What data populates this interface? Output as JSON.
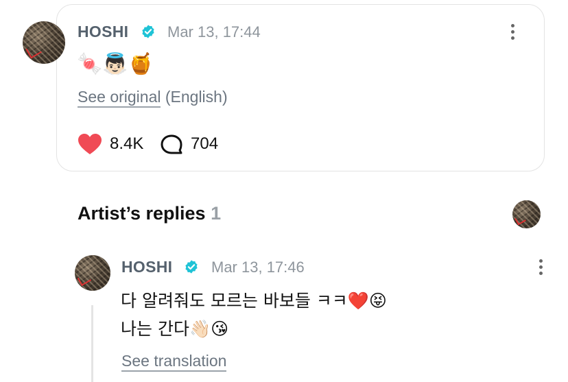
{
  "post": {
    "author": "HOSHI",
    "timestamp": "Mar 13, 17:44",
    "emojis": "🍬👼🏻🍯",
    "see_original": "See original",
    "language": "(English)",
    "likes": "8.4K",
    "comments": "704"
  },
  "replies_section": {
    "title": "Artist’s replies",
    "count": "1"
  },
  "reply": {
    "author": "HOSHI",
    "timestamp": "Mar 13, 17:46",
    "line1": "다 알려줘도 모르는 바보들 ㅋㅋ❤️😝",
    "line2": "나는 간다👋🏻😘",
    "see_translation": "See translation"
  },
  "colors": {
    "heart": "#f04a55",
    "verified": "#1fc3d6",
    "name": "#55616d",
    "muted": "#8e959c"
  },
  "icons": {
    "like": "heart-icon",
    "comment": "comment-bubble-icon",
    "more": "more-vertical-icon",
    "verified": "verified-badge-icon"
  }
}
